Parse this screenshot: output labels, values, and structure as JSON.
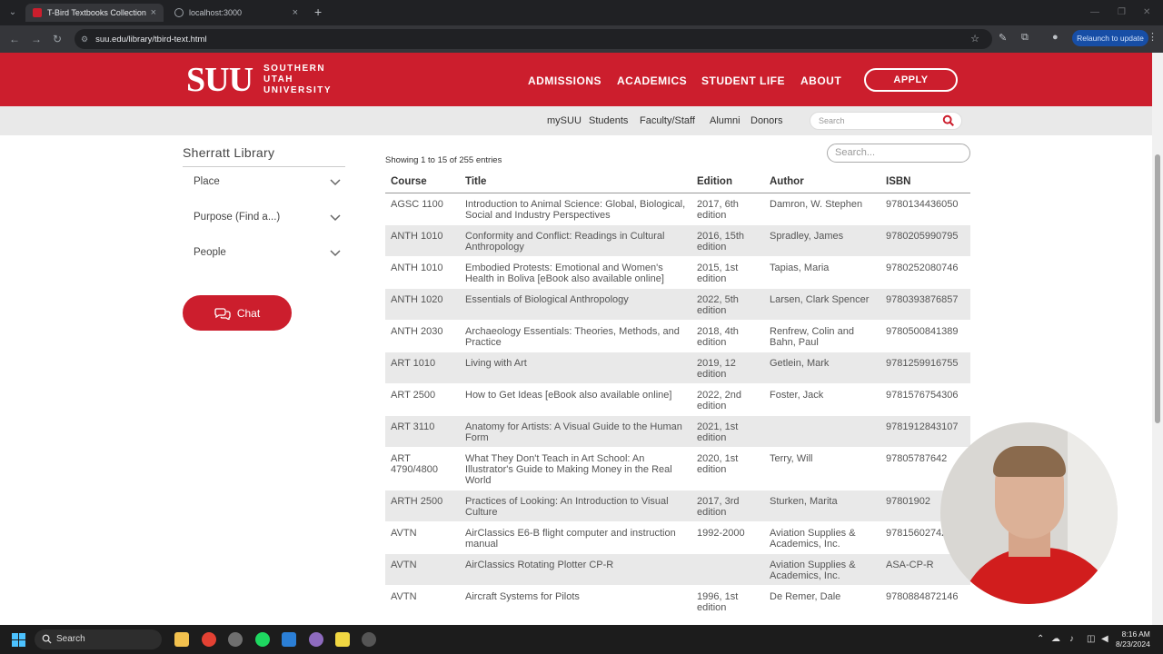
{
  "browser": {
    "tabs": [
      {
        "title": "T-Bird Textbooks Collection | SU",
        "active": true
      },
      {
        "title": "localhost:3000",
        "active": false
      }
    ],
    "url": "suu.edu/library/tbird-text.html",
    "relaunch_label": "Relaunch to update"
  },
  "header": {
    "logo_main": "SUU",
    "logo_sub": [
      "SOUTHERN",
      "UTAH",
      "UNIVERSITY"
    ],
    "nav": [
      "ADMISSIONS",
      "ACADEMICS",
      "STUDENT LIFE",
      "ABOUT"
    ],
    "apply_label": "APPLY",
    "brand_color": "#cc1e2d"
  },
  "subnav": {
    "links": [
      "mySUU",
      "Students",
      "Faculty/Staff",
      "Alumni",
      "Donors"
    ],
    "search_placeholder": "Search"
  },
  "sidebar": {
    "title": "Sherratt Library",
    "items": [
      "Place",
      "Purpose (Find a...)",
      "People"
    ],
    "chat_label": "Chat"
  },
  "table": {
    "info": "Showing 1 to 15 of 255 entries",
    "search_placeholder": "Search...",
    "columns": [
      "Course",
      "Title",
      "Edition",
      "Author",
      "ISBN"
    ],
    "rows": [
      [
        "AGSC 1100",
        "Introduction to Animal Science: Global, Biological, Social and Industry Perspectives",
        "2017, 6th edition",
        "Damron, W. Stephen",
        "9780134436050"
      ],
      [
        "ANTH 1010",
        "Conformity and Conflict: Readings in Cultural Anthropology",
        "2016, 15th edition",
        "Spradley, James",
        "9780205990795"
      ],
      [
        "ANTH 1010",
        "Embodied Protests: Emotional and Women's Health in Boliva [eBook also available online]",
        "2015, 1st edition",
        "Tapias, Maria",
        "9780252080746"
      ],
      [
        "ANTH 1020",
        "Essentials of Biological Anthropology",
        "2022, 5th edition",
        "Larsen, Clark Spencer",
        "9780393876857"
      ],
      [
        "ANTH 2030",
        "Archaeology Essentials: Theories, Methods, and Practice",
        "2018, 4th edition",
        "Renfrew, Colin and Bahn, Paul",
        "9780500841389"
      ],
      [
        "ART 1010",
        "Living with Art",
        "2019, 12 edition",
        "Getlein, Mark",
        "9781259916755"
      ],
      [
        "ART 2500",
        "How to Get Ideas [eBook also available online]",
        "2022, 2nd edition",
        "Foster, Jack",
        "9781576754306"
      ],
      [
        "ART 3110",
        "Anatomy for Artists: A Visual Guide to the Human Form",
        "2021, 1st edition",
        "",
        "9781912843107"
      ],
      [
        "ART 4790/4800",
        "What They Don't Teach in Art School: An Illustrator's Guide to Making Money in the Real World",
        "2020, 1st edition",
        "Terry, Will",
        "97805787642"
      ],
      [
        "ARTH 2500",
        "Practices of Looking: An Introduction to Visual Culture",
        "2017, 3rd edition",
        "Sturken, Marita",
        "97801902"
      ],
      [
        "AVTN",
        "AirClassics E6-B flight computer and instruction manual",
        "1992-2000",
        "Aviation Supplies & Academics, Inc.",
        "97815602742"
      ],
      [
        "AVTN",
        "AirClassics Rotating Plotter CP-R",
        "",
        "Aviation Supplies & Academics, Inc.",
        "ASA-CP-R"
      ],
      [
        "AVTN",
        "Aircraft Systems for Pilots",
        "1996, 1st edition",
        "De Remer, Dale",
        "9780884872146"
      ]
    ]
  },
  "taskbar": {
    "search_label": "Search",
    "time": "8:16 AM",
    "date": "8/23/2024"
  }
}
